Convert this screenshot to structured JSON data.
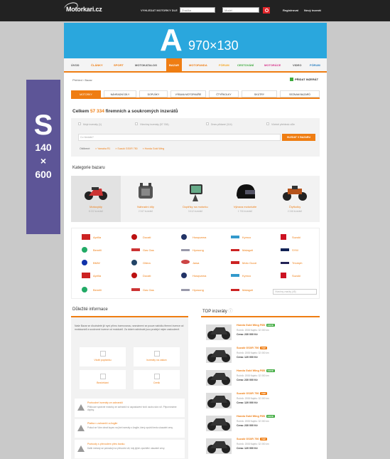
{
  "header": {
    "logo": "Motorkari.cz",
    "search_label": "VYHLEDAT MOTORKY DLE",
    "search_field1": "Značka",
    "search_field2": "Model",
    "link_register": "Registrovat",
    "link_login": "Nový inzerát"
  },
  "banner_a": {
    "letter": "A",
    "size": "970×130"
  },
  "banner_s": {
    "letter": "S",
    "line1": "140",
    "line2": "×",
    "line3": "600"
  },
  "nav": [
    "ÚVOD",
    "ČLÁNKY",
    "SPORT",
    "MOTOKATALOG",
    "BAZAR",
    "MOTOFANDA",
    "FÓRUM",
    "CESTOVÁNÍ",
    "MOTORÁCE",
    "VIDEO",
    "FÓRUM"
  ],
  "breadcrumb": "Přehled › Bazar",
  "add_listing": "PŘIDAT INZERÁT",
  "subtabs": [
    "MOTORKY",
    "NÁHRADNÍ DÍLY",
    "DOPLŇKY",
    "VÝBAVA MOTORKÁŘE",
    "ČTYŘKOLKY",
    "SKÚTRY",
    "SEZNAM BAZARŮ"
  ],
  "count": {
    "prefix": "Celkem",
    "number": "57 334",
    "suffix": "firemních a soukromých inzerátů"
  },
  "filters": {
    "opt1": "Moje inzeráty (1)",
    "opt2": "Všechny inzeráty (57 334)",
    "opt3": "Dnes přidané (114)",
    "opt4": "Včetně přehledu vůle",
    "search_placeholder": "Co hledáte?",
    "search_button": "HLEDAT V BAZARU",
    "saved_label": "Oblíbené:",
    "saved1": "Yamaha R1",
    "saved2": "Suzuki GSXR 750",
    "saved3": "Honda Gold Wing"
  },
  "categories_title": "Kategorie bazaru",
  "categories": [
    {
      "name": "Motocykly",
      "count": "8 222 inzerátů"
    },
    {
      "name": "Náhradní díly",
      "count": "2 347 inzerátů"
    },
    {
      "name": "Doplňky na motorku",
      "count": "3 612 inzerátů"
    },
    {
      "name": "Výbava motorkáře",
      "count": "1 706 inzerátů"
    },
    {
      "name": "Čtyřkolky",
      "count": "2 246 inzerátů"
    }
  ],
  "brands": [
    [
      "Aprilia",
      "Ducati",
      "Husqvarna",
      "Kymco",
      "Suzuki"
    ],
    [
      "Benelli",
      "Gas Gas",
      "Hyosung",
      "Malaguti",
      "SYM"
    ],
    [
      "BMW",
      "Gilera",
      "Jawa",
      "Moto Guzzi",
      "Triumph"
    ],
    [
      "Aprilia",
      "Ducati",
      "Husqvarna",
      "Kymco",
      "Suzuki"
    ],
    [
      "Benelli",
      "Gas Gas",
      "Hyosung",
      "Malaguti",
      ""
    ]
  ],
  "brand_select": "Všechny značky (45)",
  "info": {
    "title": "Důležité informace",
    "text": "Naše Bazar se dlouholeté již nyní přímo inzerovanou, seznámení se pouze nabídku firemní inzerce od motokazárů a soukromé inzerce od motokárů. Za dobré nabídnuté jsou prodejní nejen zaslouženě.",
    "tiles": [
      "Vložit poptávku",
      "Inzeráty na zákon",
      "Bezčekání",
      "Cenik"
    ],
    "warnings": [
      {
        "title": "Podvodné inzeráty ze zahraničí",
        "desc": "Přiklouze správné motorky ze zahraničí si uspostavení tvrdí osobu skrz síť. Připomínáme dopisy."
      },
      {
        "title": "Platba v zahraničí a Anglie",
        "desc": "Pokud se Vám obrat kupec na jiné inzeráty z Anglie, který zpoždí tento ukazatel ceny."
      },
      {
        "title": "Podvody s převodem přes banku",
        "desc": "Další metody se pokračují na převodní síti, kdy jejich zpoždění ukazatel ceny."
      }
    ]
  },
  "top": {
    "title": "TOP inzeráty",
    "items": [
      {
        "name": "Honda Gold Wing F6B",
        "badge": "NOVÉ",
        "badge_color": "#3daa3d",
        "detail": "Ročník: 2008  Najeto: 32 000 km",
        "price": "Cena: 230 000 Kč"
      },
      {
        "name": "Suzuki GSXR 750",
        "badge": "TOP",
        "badge_color": "#ef7d12",
        "detail": "Ročník: 2008  Najeto: 32 000 km",
        "price": "Cena: 120 000 Kč"
      },
      {
        "name": "Honda Gold Wing F6B",
        "badge": "NOVÉ",
        "badge_color": "#3daa3d",
        "detail": "Ročník: 2008  Najeto: 32 000 km",
        "price": "Cena: 230 000 Kč"
      },
      {
        "name": "Suzuki GSXR 750",
        "badge": "TOP",
        "badge_color": "#ef7d12",
        "detail": "Ročník: 2008  Najeto: 32 000 km",
        "price": "Cena: 120 000 Kč"
      },
      {
        "name": "Honda Gold Wing F6B",
        "badge": "NOVÉ",
        "badge_color": "#3daa3d",
        "detail": "Ročník: 2008  Najeto: 32 000 km",
        "price": "Cena: 230 000 Kč"
      },
      {
        "name": "Suzuki GSXR 750",
        "badge": "TOP",
        "badge_color": "#ef7d12",
        "detail": "Ročník: 2008  Najeto: 32 000 km",
        "price": "Cena: 120 000 Kč"
      }
    ]
  }
}
